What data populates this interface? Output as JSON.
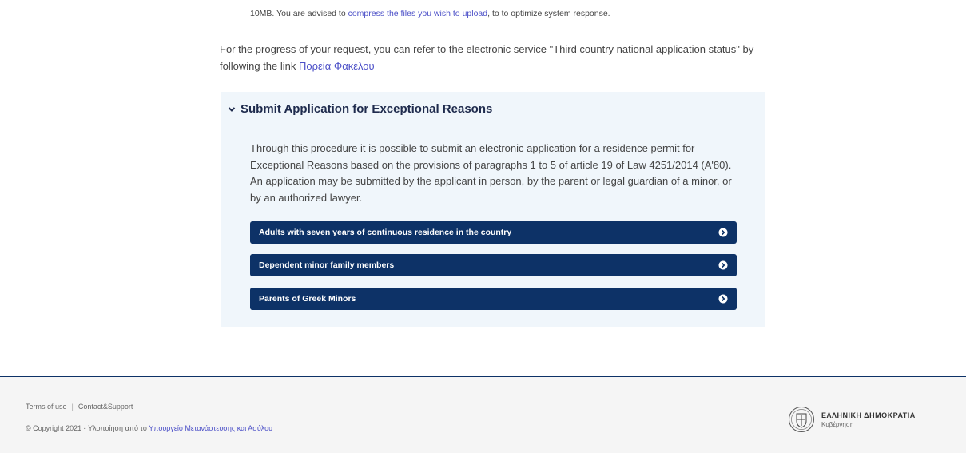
{
  "top_note": {
    "prefix": "10MB. You are advised to ",
    "link": "compress the files you wish to upload",
    "suffix": ", to to optimize system response."
  },
  "progress": {
    "text": "For the progress of your request, you can refer to the electronic service \"Third country national application status\" by following the link ",
    "link": "Πορεία Φακέλου"
  },
  "panel": {
    "title": "Submit Application for Exceptional Reasons",
    "description": "Through this procedure it is possible to submit an electronic application for a residence permit for Exceptional Reasons based on the provisions of paragraphs 1 to 5 of article 19 of Law 4251/2014 (A'80). An application may be submitted by the applicant in person, by the parent or legal guardian of a minor, or by an authorized lawyer.",
    "options": [
      {
        "label": "Adults with seven years of continuous residence in the country"
      },
      {
        "label": "Dependent minor family members"
      },
      {
        "label": "Parents of Greek Minors"
      }
    ]
  },
  "footer": {
    "terms": "Terms of use",
    "contact": "Contact&Support",
    "copyright_prefix": "© Copyright 2021 - Υλοποίηση από το ",
    "copyright_link": "Υπουργείο Μετανάστευσης και Ασύλου",
    "gov_name": "ΕΛΛΗΝΙΚΗ ΔΗΜΟΚΡΑΤΙΑ",
    "gov_sub": "Κυβέρνηση"
  },
  "colors": {
    "accent": "#0d3267",
    "link": "#4b4fc7",
    "panel_bg": "#f0f6fb"
  },
  "icons": {
    "panel_toggle": "chevron-down-icon",
    "option_arrow": "circle-arrow-right-icon",
    "gov_emblem": "greek-government-emblem-icon"
  }
}
